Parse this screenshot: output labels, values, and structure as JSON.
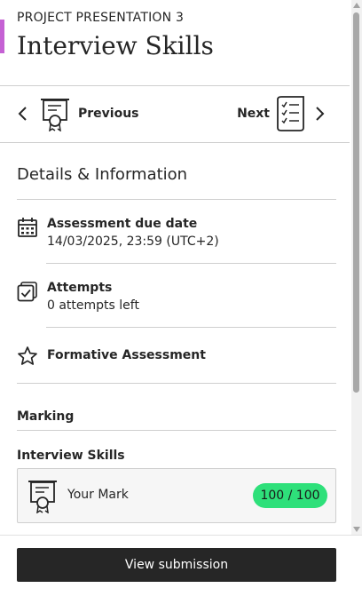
{
  "header": {
    "eyebrow": "PROJECT PRESENTATION 3",
    "title": "Interview Skills",
    "accent_color": "#c561d4"
  },
  "navigation": {
    "previous_label": "Previous",
    "next_label": "Next"
  },
  "details": {
    "section_title": "Details & Information",
    "items": [
      {
        "icon": "calendar-icon",
        "label": "Assessment due date",
        "value": "14/03/2025, 23:59 (UTC+2)"
      },
      {
        "icon": "attempts-icon",
        "label": "Attempts",
        "value": "0 attempts left"
      },
      {
        "icon": "star-icon",
        "label": "Formative Assessment"
      }
    ]
  },
  "marking": {
    "heading": "Marking",
    "criterion_title": "Interview Skills",
    "mark_label": "Your Mark",
    "mark_value": "100 / 100",
    "badge_color": "#2ee07a"
  },
  "footer": {
    "view_submission_label": "View submission"
  }
}
